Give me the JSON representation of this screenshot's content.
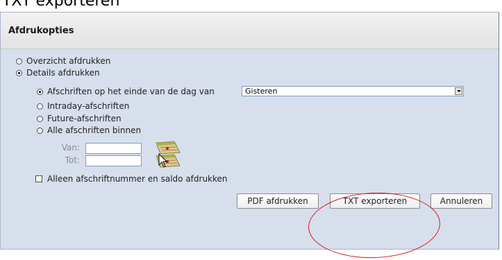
{
  "page_heading": "TXT exporteren",
  "dialog": {
    "title": "Afdrukopties",
    "print_mode": {
      "options": [
        {
          "label": "Overzicht afdrukken",
          "checked": false
        },
        {
          "label": "Details afdrukken",
          "checked": true
        }
      ]
    },
    "statement_options": [
      {
        "label": "Afschriften op het einde van de dag van",
        "checked": true
      },
      {
        "label": "Intraday-afschriften",
        "checked": false
      },
      {
        "label": "Future-afschriften",
        "checked": false
      },
      {
        "label": "Alle afschriften binnen",
        "checked": false
      }
    ],
    "day_select": {
      "value": "Gisteren"
    },
    "date_range": {
      "from_label": "Van:",
      "to_label": "Tot:",
      "from_value": "",
      "to_value": ""
    },
    "only_number_balance": {
      "label": "Alleen afschriftnummer en saldo afdrukken",
      "checked": false
    },
    "buttons": {
      "pdf": "PDF afdrukken",
      "txt": "TXT exporteren",
      "cancel": "Annuleren"
    }
  },
  "colors": {
    "highlight": "#e0141e",
    "body_background": "#d7dfec"
  },
  "icons": [
    "calendar-icon",
    "mouse-pointer-icon"
  ]
}
